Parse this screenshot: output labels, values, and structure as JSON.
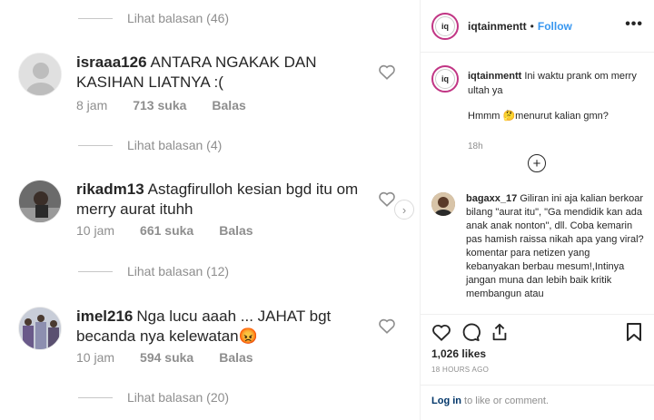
{
  "left": {
    "view_replies": [
      "Lihat balasan (46)",
      "Lihat balasan (4)",
      "Lihat balasan (12)",
      "Lihat balasan (20)"
    ],
    "comments": [
      {
        "username": "israaa126",
        "text": "ANTARA NGAKAK DAN KASIHAN LIATNYA :(",
        "time": "8 jam",
        "likes": "713 suka",
        "reply": "Balas"
      },
      {
        "username": "rikadm13",
        "text": "Astagfirulloh kesian bgd itu om merry aurat ituhh",
        "time": "10 jam",
        "likes": "661 suka",
        "reply": "Balas"
      },
      {
        "username": "imel216",
        "text": "Nga lucu aaah ... JAHAT bgt becanda nya kelewatan😡",
        "time": "10 jam",
        "likes": "594 suka",
        "reply": "Balas"
      }
    ]
  },
  "post": {
    "account": "iqtainmentt",
    "separator": "•",
    "follow": "Follow",
    "more": "•••",
    "avatar_text": "iq",
    "caption_username": "iqtainmentt",
    "caption_line1": "Ini waktu prank om merry ultah ya",
    "caption_line2": "Hmmm 🤔menurut kalian gmn?",
    "caption_time": "18h",
    "comment": {
      "username": "bagaxx_17",
      "text": "Giliran ini aja kalian berkoar bilang \"aurat itu\", \"Ga mendidik kan ada anak anak nonton\", dll. Coba kemarin pas hamish raissa nikah apa yang viral?komentar para netizen yang kebanyakan berbau mesum!,Intinya jangan muna dan lebih baik kritik membangun atau"
    },
    "likes": "1,026 likes",
    "posted_ago": "18 HOURS AGO",
    "login_link": "Log in",
    "login_rest": " to like or comment."
  },
  "colors": {
    "link": "#3897f0",
    "ring": "#c13584",
    "muted": "#8e8e8e"
  },
  "icons": [
    "heart-icon",
    "comment-icon",
    "share-icon",
    "bookmark-icon",
    "plus-circle-icon",
    "chevron-right-icon"
  ]
}
